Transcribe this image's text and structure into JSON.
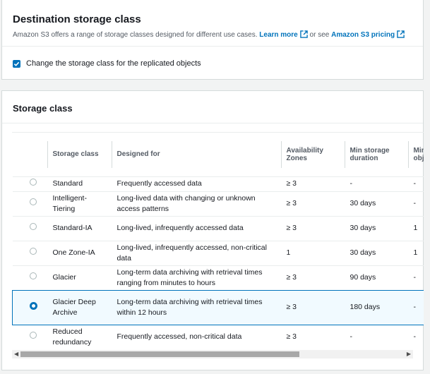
{
  "destination": {
    "title": "Destination storage class",
    "description": "Amazon S3 offers a range of storage classes designed for different use cases.",
    "learn_more": "Learn more",
    "or_see": "or see",
    "pricing_link": "Amazon S3 pricing",
    "checkbox_label": "Change the storage class for the replicated objects",
    "checkbox_checked": true
  },
  "storage_class": {
    "title": "Storage class",
    "columns": [
      "Storage class",
      "Designed for",
      "Availability Zones",
      "Min storage duration",
      "Min billable object size"
    ],
    "rows": [
      {
        "name": "Standard",
        "designed_for": "Frequently accessed data",
        "az": "≥ 3",
        "min_duration": "-",
        "min_size": "-",
        "selected": false
      },
      {
        "name": "Intelligent-Tiering",
        "designed_for": "Long-lived data with changing or unknown access patterns",
        "az": "≥ 3",
        "min_duration": "30 days",
        "min_size": "-",
        "selected": false
      },
      {
        "name": "Standard-IA",
        "designed_for": "Long-lived, infrequently accessed data",
        "az": "≥ 3",
        "min_duration": "30 days",
        "min_size": "1",
        "selected": false
      },
      {
        "name": "One Zone-IA",
        "designed_for": "Long-lived, infrequently accessed, non-critical data",
        "az": "1",
        "min_duration": "30 days",
        "min_size": "1",
        "selected": false
      },
      {
        "name": "Glacier",
        "designed_for": "Long-term data archiving with retrieval times ranging from minutes to hours",
        "az": "≥ 3",
        "min_duration": "90 days",
        "min_size": "-",
        "selected": false
      },
      {
        "name": "Glacier Deep Archive",
        "designed_for": "Long-term data archiving with retrieval times within 12 hours",
        "az": "≥ 3",
        "min_duration": "180 days",
        "min_size": "-",
        "selected": true
      },
      {
        "name": "Reduced redundancy",
        "designed_for": "Frequently accessed, non-critical data",
        "az": "≥ 3",
        "min_duration": "-",
        "min_size": "-",
        "selected": false
      }
    ]
  },
  "colors": {
    "accent": "#0073bb",
    "selected_bg": "#f1faff"
  }
}
